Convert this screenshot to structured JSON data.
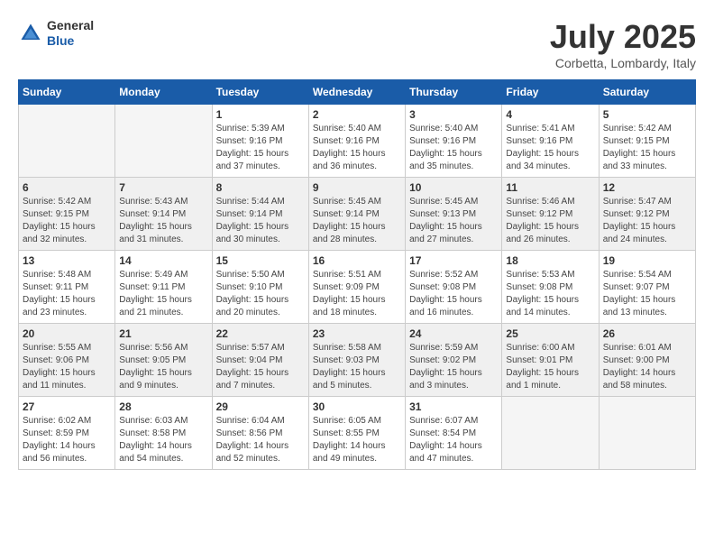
{
  "header": {
    "logo": {
      "general": "General",
      "blue": "Blue"
    },
    "title": "July 2025",
    "location": "Corbetta, Lombardy, Italy"
  },
  "days_of_week": [
    "Sunday",
    "Monday",
    "Tuesday",
    "Wednesday",
    "Thursday",
    "Friday",
    "Saturday"
  ],
  "weeks": [
    [
      {
        "day": "",
        "info": ""
      },
      {
        "day": "",
        "info": ""
      },
      {
        "day": "1",
        "info": "Sunrise: 5:39 AM\nSunset: 9:16 PM\nDaylight: 15 hours\nand 37 minutes."
      },
      {
        "day": "2",
        "info": "Sunrise: 5:40 AM\nSunset: 9:16 PM\nDaylight: 15 hours\nand 36 minutes."
      },
      {
        "day": "3",
        "info": "Sunrise: 5:40 AM\nSunset: 9:16 PM\nDaylight: 15 hours\nand 35 minutes."
      },
      {
        "day": "4",
        "info": "Sunrise: 5:41 AM\nSunset: 9:16 PM\nDaylight: 15 hours\nand 34 minutes."
      },
      {
        "day": "5",
        "info": "Sunrise: 5:42 AM\nSunset: 9:15 PM\nDaylight: 15 hours\nand 33 minutes."
      }
    ],
    [
      {
        "day": "6",
        "info": "Sunrise: 5:42 AM\nSunset: 9:15 PM\nDaylight: 15 hours\nand 32 minutes."
      },
      {
        "day": "7",
        "info": "Sunrise: 5:43 AM\nSunset: 9:14 PM\nDaylight: 15 hours\nand 31 minutes."
      },
      {
        "day": "8",
        "info": "Sunrise: 5:44 AM\nSunset: 9:14 PM\nDaylight: 15 hours\nand 30 minutes."
      },
      {
        "day": "9",
        "info": "Sunrise: 5:45 AM\nSunset: 9:14 PM\nDaylight: 15 hours\nand 28 minutes."
      },
      {
        "day": "10",
        "info": "Sunrise: 5:45 AM\nSunset: 9:13 PM\nDaylight: 15 hours\nand 27 minutes."
      },
      {
        "day": "11",
        "info": "Sunrise: 5:46 AM\nSunset: 9:12 PM\nDaylight: 15 hours\nand 26 minutes."
      },
      {
        "day": "12",
        "info": "Sunrise: 5:47 AM\nSunset: 9:12 PM\nDaylight: 15 hours\nand 24 minutes."
      }
    ],
    [
      {
        "day": "13",
        "info": "Sunrise: 5:48 AM\nSunset: 9:11 PM\nDaylight: 15 hours\nand 23 minutes."
      },
      {
        "day": "14",
        "info": "Sunrise: 5:49 AM\nSunset: 9:11 PM\nDaylight: 15 hours\nand 21 minutes."
      },
      {
        "day": "15",
        "info": "Sunrise: 5:50 AM\nSunset: 9:10 PM\nDaylight: 15 hours\nand 20 minutes."
      },
      {
        "day": "16",
        "info": "Sunrise: 5:51 AM\nSunset: 9:09 PM\nDaylight: 15 hours\nand 18 minutes."
      },
      {
        "day": "17",
        "info": "Sunrise: 5:52 AM\nSunset: 9:08 PM\nDaylight: 15 hours\nand 16 minutes."
      },
      {
        "day": "18",
        "info": "Sunrise: 5:53 AM\nSunset: 9:08 PM\nDaylight: 15 hours\nand 14 minutes."
      },
      {
        "day": "19",
        "info": "Sunrise: 5:54 AM\nSunset: 9:07 PM\nDaylight: 15 hours\nand 13 minutes."
      }
    ],
    [
      {
        "day": "20",
        "info": "Sunrise: 5:55 AM\nSunset: 9:06 PM\nDaylight: 15 hours\nand 11 minutes."
      },
      {
        "day": "21",
        "info": "Sunrise: 5:56 AM\nSunset: 9:05 PM\nDaylight: 15 hours\nand 9 minutes."
      },
      {
        "day": "22",
        "info": "Sunrise: 5:57 AM\nSunset: 9:04 PM\nDaylight: 15 hours\nand 7 minutes."
      },
      {
        "day": "23",
        "info": "Sunrise: 5:58 AM\nSunset: 9:03 PM\nDaylight: 15 hours\nand 5 minutes."
      },
      {
        "day": "24",
        "info": "Sunrise: 5:59 AM\nSunset: 9:02 PM\nDaylight: 15 hours\nand 3 minutes."
      },
      {
        "day": "25",
        "info": "Sunrise: 6:00 AM\nSunset: 9:01 PM\nDaylight: 15 hours\nand 1 minute."
      },
      {
        "day": "26",
        "info": "Sunrise: 6:01 AM\nSunset: 9:00 PM\nDaylight: 14 hours\nand 58 minutes."
      }
    ],
    [
      {
        "day": "27",
        "info": "Sunrise: 6:02 AM\nSunset: 8:59 PM\nDaylight: 14 hours\nand 56 minutes."
      },
      {
        "day": "28",
        "info": "Sunrise: 6:03 AM\nSunset: 8:58 PM\nDaylight: 14 hours\nand 54 minutes."
      },
      {
        "day": "29",
        "info": "Sunrise: 6:04 AM\nSunset: 8:56 PM\nDaylight: 14 hours\nand 52 minutes."
      },
      {
        "day": "30",
        "info": "Sunrise: 6:05 AM\nSunset: 8:55 PM\nDaylight: 14 hours\nand 49 minutes."
      },
      {
        "day": "31",
        "info": "Sunrise: 6:07 AM\nSunset: 8:54 PM\nDaylight: 14 hours\nand 47 minutes."
      },
      {
        "day": "",
        "info": ""
      },
      {
        "day": "",
        "info": ""
      }
    ]
  ]
}
